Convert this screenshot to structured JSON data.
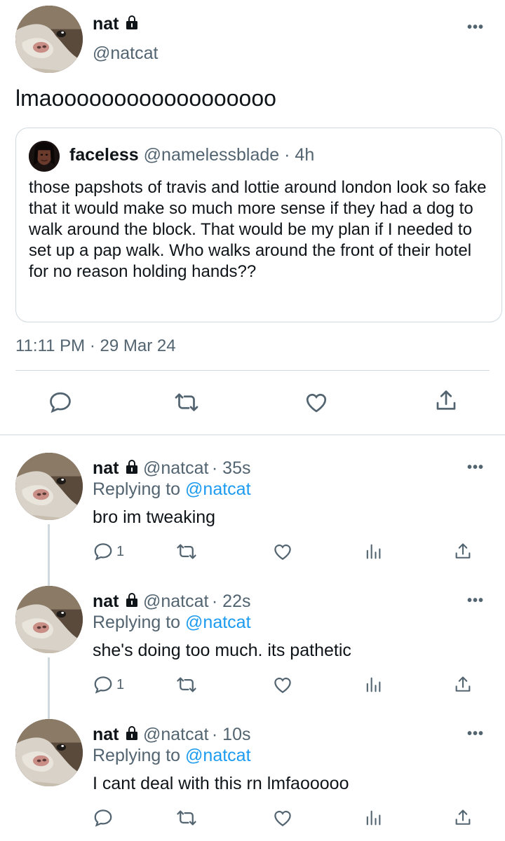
{
  "main_tweet": {
    "name": "nat",
    "handle": "@natcat",
    "text": "lmaoooooooooooooooooo",
    "timestamp": "11:11 PM · 29 Mar 24",
    "more": "•••"
  },
  "quoted": {
    "name": "faceless",
    "handle": "@namelessblade",
    "time": "· 4h",
    "text": "those papshots of travis and lottie around london look so fake that it would make so much more sense if they had a dog to walk around the block. That would be my plan if I needed to set up a pap walk. Who walks around the front of their hotel for no reason holding hands??"
  },
  "replies": [
    {
      "name": "nat",
      "handle": "@natcat",
      "time": "· 35s",
      "replying_prefix": "Replying to",
      "replying_to": "@natcat",
      "text": "bro im tweaking",
      "reply_count": "1"
    },
    {
      "name": "nat",
      "handle": "@natcat",
      "time": "· 22s",
      "replying_prefix": "Replying to",
      "replying_to": "@natcat",
      "text": "she's doing too much. its pathetic",
      "reply_count": "1"
    },
    {
      "name": "nat",
      "handle": "@natcat",
      "time": "· 10s",
      "replying_prefix": "Replying to",
      "replying_to": "@natcat",
      "text": "I cant deal with this rn lmfaooooo",
      "reply_count": ""
    }
  ],
  "colors": {
    "text": "#0f1419",
    "secondary": "#536471",
    "link": "#1d9bf0",
    "border": "#cfd9de"
  }
}
